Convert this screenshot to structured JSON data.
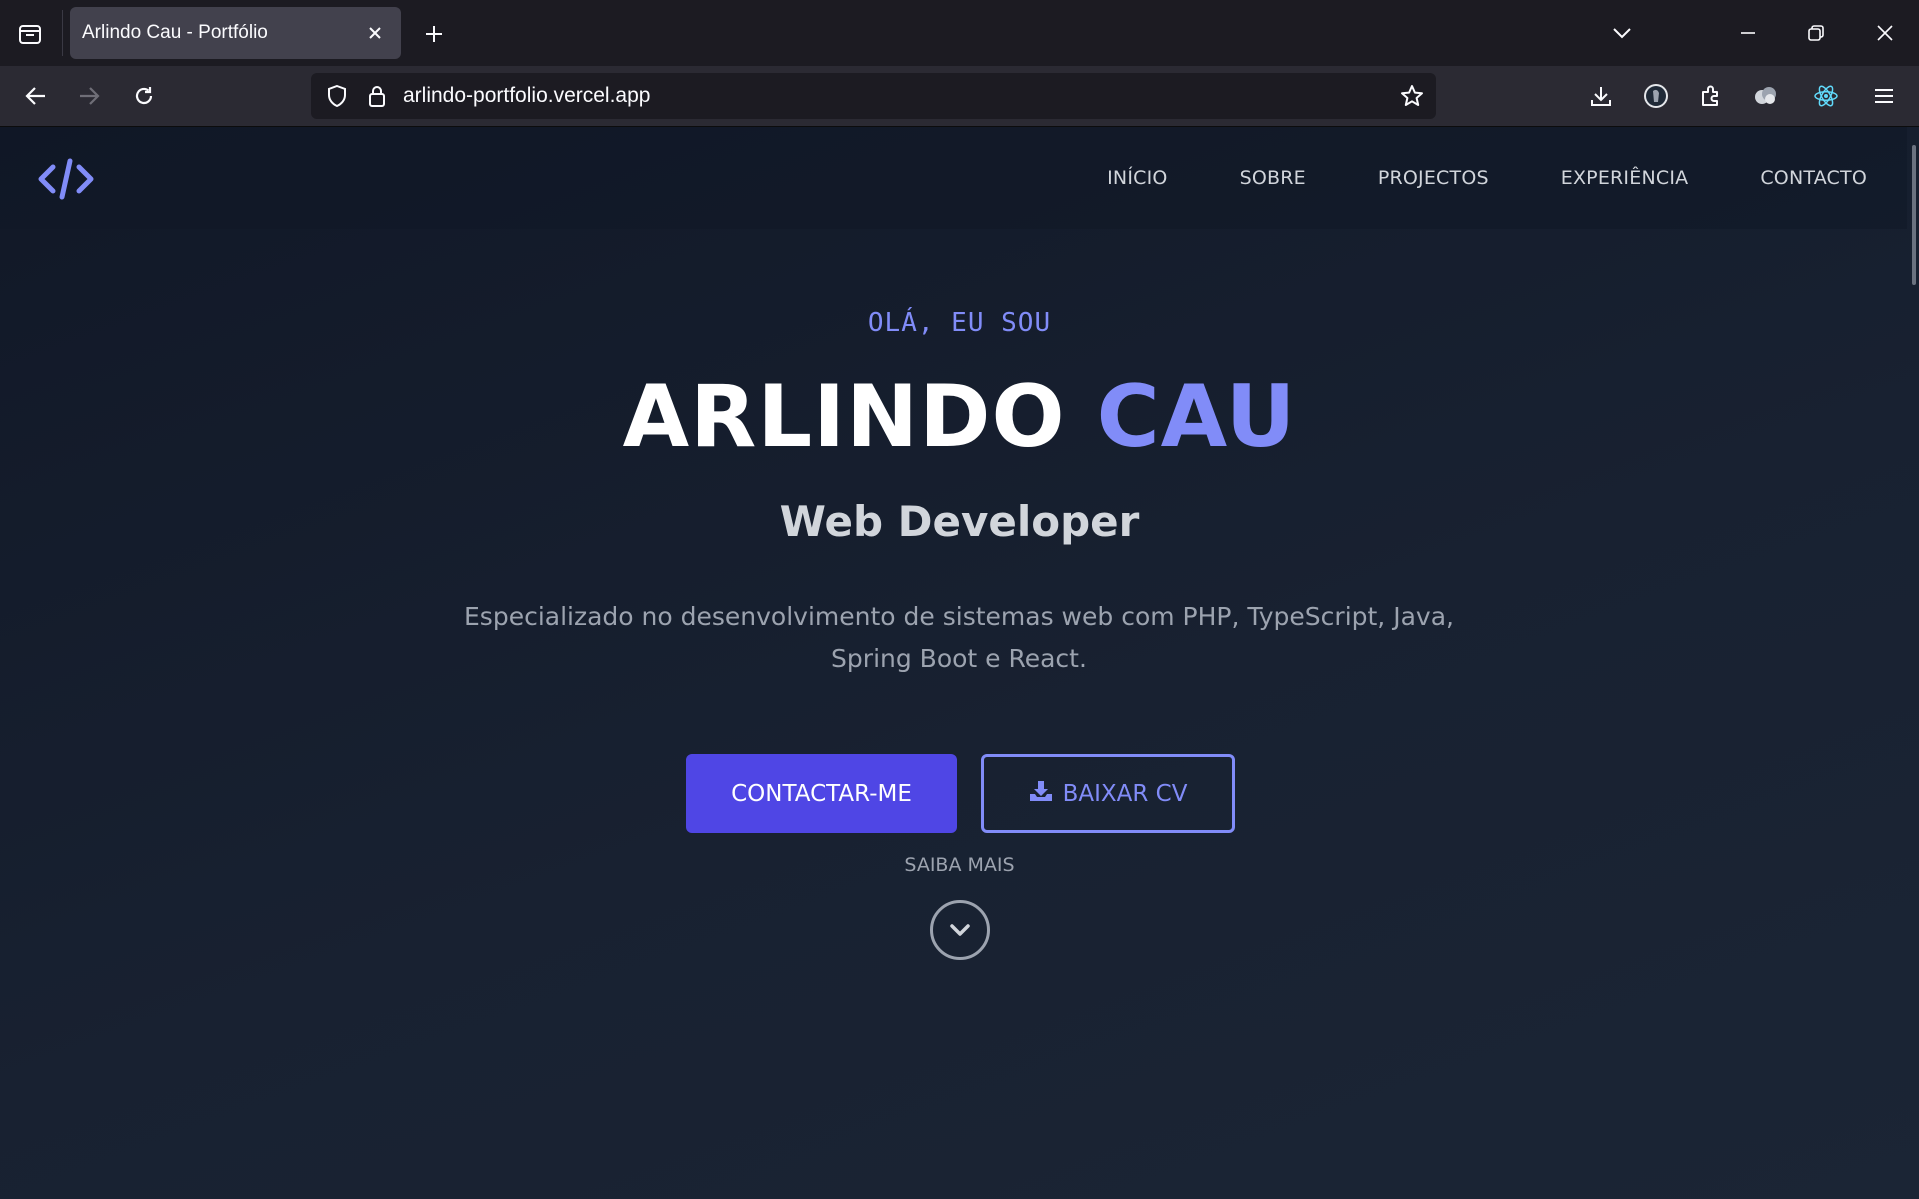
{
  "browser": {
    "tab": {
      "title": "Arlindo Cau - Portfólio"
    },
    "url": "arlindo-portfolio.vercel.app"
  },
  "site": {
    "nav": [
      {
        "label": "INÍCIO"
      },
      {
        "label": "SOBRE"
      },
      {
        "label": "PROJECTOS"
      },
      {
        "label": "EXPERIÊNCIA"
      },
      {
        "label": "CONTACTO"
      }
    ],
    "hero": {
      "greeting": "OLÁ, EU SOU",
      "name_first": "ARLINDO",
      "name_last": "CAU",
      "role": "Web Developer",
      "description": "Especializado no desenvolvimento de sistemas web com PHP, TypeScript, Java, Spring Boot e React.",
      "primary_button": "CONTACTAR-ME",
      "secondary_button": "BAIXAR CV",
      "learn_more": "SAIBA MAIS"
    }
  },
  "colors": {
    "accent": "#818cf8",
    "primary_button": "#4f46e5",
    "page_background": "#111827"
  }
}
